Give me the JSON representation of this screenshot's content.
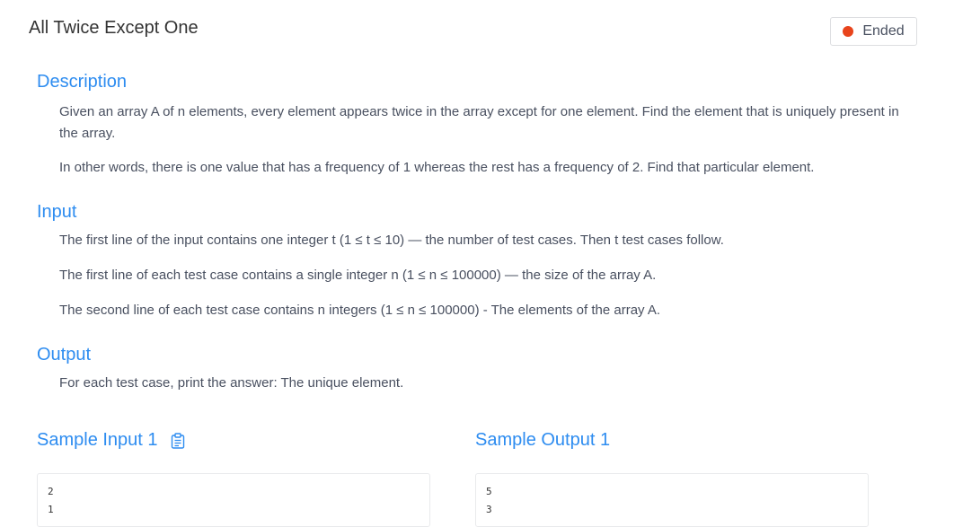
{
  "problem": {
    "title": "All Twice Except One",
    "status": {
      "label": "Ended",
      "color": "#e8441c"
    }
  },
  "description": {
    "heading": "Description",
    "paragraphs": [
      "Given an array A of n elements, every element appears twice in the array except for one element. Find the element that is uniquely present in the array.",
      "In other words, there is one value that has a frequency of 1 whereas the rest has a frequency of 2. Find that particular element."
    ]
  },
  "input": {
    "heading": "Input",
    "paragraphs": [
      "The first line of the input contains one integer t (1 ≤ t ≤ 10) — the number of test cases. Then t test cases follow.",
      "The first line of each test case contains a single integer n (1 ≤ n ≤ 100000) — the size of the array A.",
      "The second line of each test case contains n integers (1 ≤ n ≤ 100000) - The elements of the array A."
    ]
  },
  "output": {
    "heading": "Output",
    "paragraphs": [
      "For each test case, print the answer: The unique element."
    ]
  },
  "samples": {
    "input_title": "Sample Input 1",
    "output_title": "Sample Output 1",
    "input_lines": [
      "2",
      "1"
    ],
    "output_lines": [
      "5",
      "3"
    ],
    "copy_icon": "clipboard-icon"
  },
  "colors": {
    "accent": "#2d8cf0",
    "text": "#495060"
  }
}
